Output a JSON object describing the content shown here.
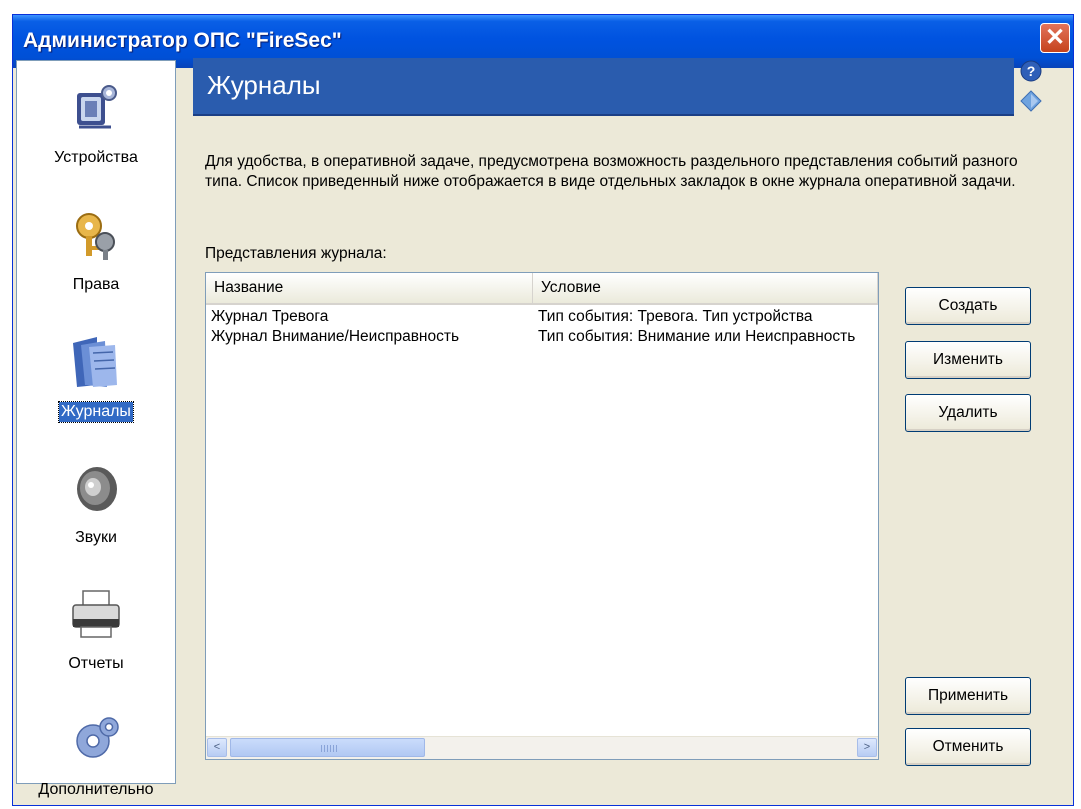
{
  "window": {
    "title": "Администратор ОПС \"FireSec\"",
    "close_label": "✕"
  },
  "sidebar": {
    "items": [
      {
        "label": "Устройства",
        "icon": "devices-icon"
      },
      {
        "label": "Права",
        "icon": "keys-icon"
      },
      {
        "label": "Журналы",
        "icon": "journals-icon",
        "active": true
      },
      {
        "label": "Звуки",
        "icon": "speaker-icon"
      },
      {
        "label": "Отчеты",
        "icon": "printer-icon"
      },
      {
        "label": "Дополнительно",
        "icon": "gear-icon"
      }
    ]
  },
  "header": {
    "title": "Журналы"
  },
  "description": "Для удобства, в оперативной задаче, предусмотрена возможность раздельного представления событий разного типа. Список приведенный ниже отображается в виде отдельных закладок в окне журнала оперативной задачи.",
  "list": {
    "label": "Представления журнала:",
    "columns": [
      "Название",
      "Условие"
    ],
    "rows": [
      {
        "name": "Журнал Тревога",
        "condition": "Тип события: Тревога. Тип устройства"
      },
      {
        "name": "Журнал Внимание/Неисправность",
        "condition": "Тип события: Внимание или Неисправность"
      }
    ],
    "scroll_left": "<",
    "scroll_right": ">"
  },
  "buttons": {
    "create": "Создать",
    "edit": "Изменить",
    "delete": "Удалить",
    "apply": "Применить",
    "cancel": "Отменить"
  },
  "colors": {
    "header_blue": "#2a5cae",
    "title_bar": "#0053e0",
    "selection": "#316ac5"
  }
}
